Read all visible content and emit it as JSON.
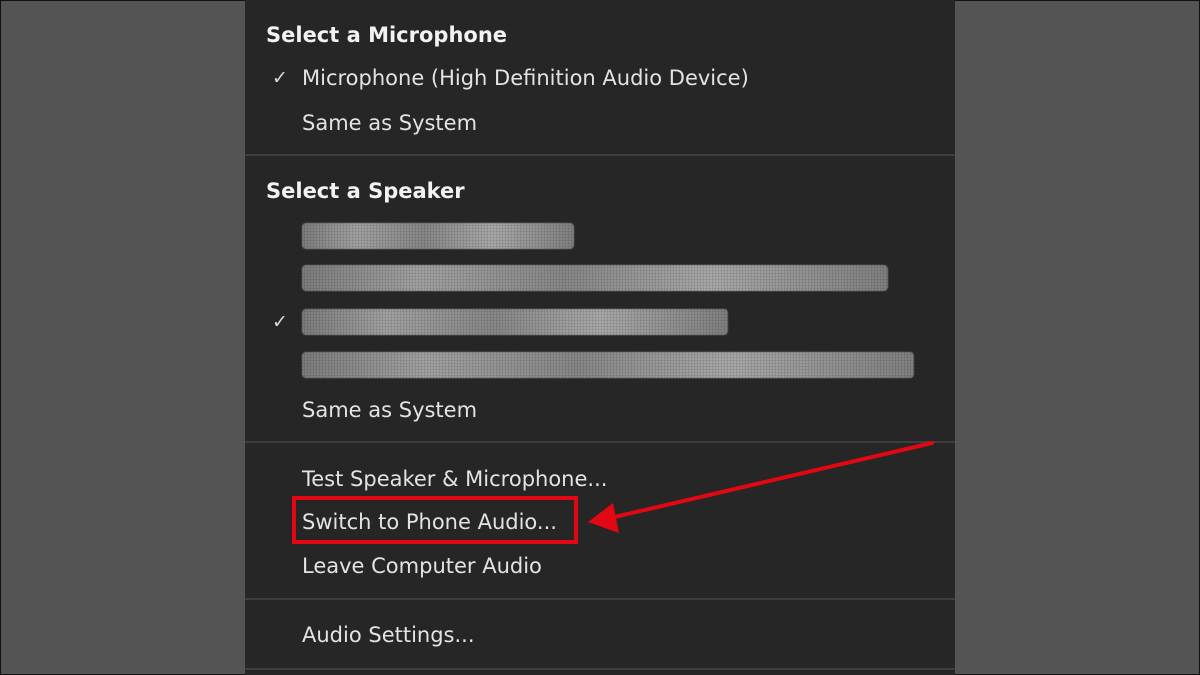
{
  "microphone": {
    "header": "Select a Microphone",
    "items": [
      {
        "label": "Microphone (High Definition Audio Device)",
        "checked": true
      },
      {
        "label": "Same as System",
        "checked": false
      }
    ]
  },
  "speaker": {
    "header": "Select a Speaker",
    "items": [
      {
        "label": "",
        "checked": false,
        "redacted": true
      },
      {
        "label": "",
        "checked": false,
        "redacted": true
      },
      {
        "label": "",
        "checked": true,
        "redacted": true
      },
      {
        "label": "",
        "checked": false,
        "redacted": true
      },
      {
        "label": "Same as System",
        "checked": false
      }
    ]
  },
  "actions": {
    "test": "Test Speaker & Microphone...",
    "switch_phone": "Switch to Phone Audio...",
    "leave": "Leave Computer Audio"
  },
  "settings": {
    "audio_settings": "Audio Settings..."
  },
  "icons": {
    "check": "check-icon",
    "annotation": "arrow-icon"
  },
  "colors": {
    "menu_bg": "#262626",
    "page_bg": "#545454",
    "annotation": "#e30613",
    "text": "#e3e3e3"
  }
}
